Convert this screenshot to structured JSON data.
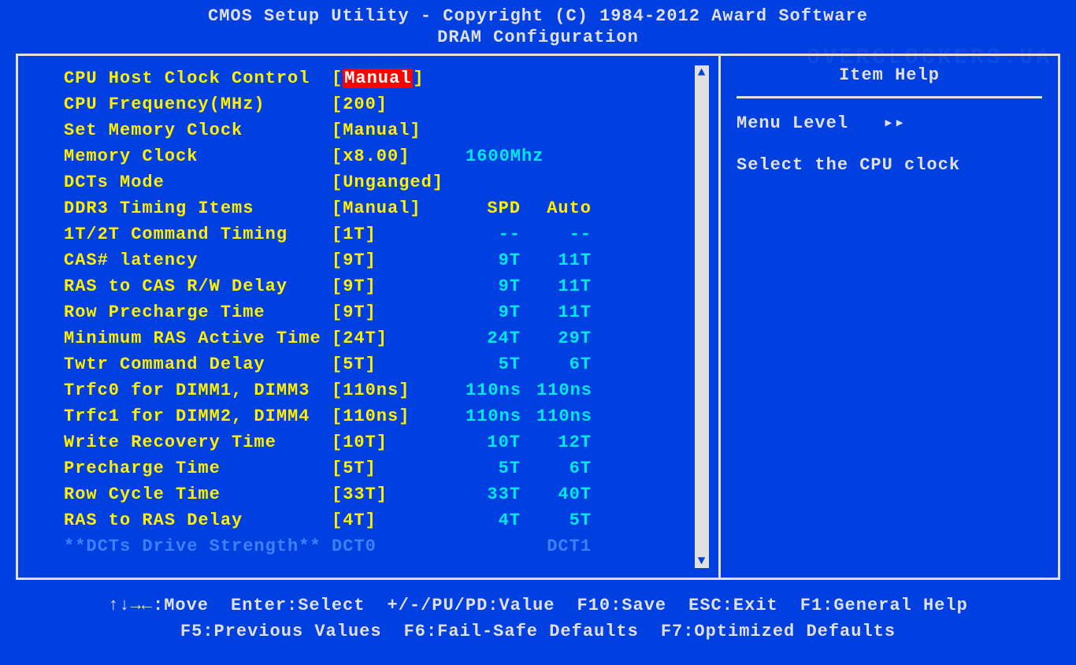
{
  "header": {
    "title": "CMOS Setup Utility - Copyright (C) 1984-2012 Award Software",
    "subtitle": "DRAM Configuration"
  },
  "watermark": "OVERCLOCKERS.UA",
  "settings": [
    {
      "label": "CPU Host Clock Control",
      "value": "Manual",
      "highlighted": true
    },
    {
      "label": "CPU Frequency(MHz)",
      "value": "200"
    },
    {
      "label": "Set Memory Clock",
      "value": "Manual"
    },
    {
      "label": "Memory Clock",
      "value": "x8.00",
      "extra": "1600Mhz"
    },
    {
      "label": "DCTs Mode",
      "value": "Unganged"
    },
    {
      "label": "DDR3 Timing Items",
      "value": "Manual",
      "spd": "SPD",
      "auto": "Auto",
      "header": true
    },
    {
      "label": "1T/2T Command Timing",
      "value": "1T",
      "spd": "--",
      "auto": "--"
    },
    {
      "label": "CAS# latency",
      "value": "9T",
      "spd": "9T",
      "auto": "11T"
    },
    {
      "label": "RAS to CAS R/W Delay",
      "value": "9T",
      "spd": "9T",
      "auto": "11T"
    },
    {
      "label": "Row Precharge Time",
      "value": "9T",
      "spd": "9T",
      "auto": "11T"
    },
    {
      "label": "Minimum RAS Active Time",
      "value": "24T",
      "spd": "24T",
      "auto": "29T"
    },
    {
      "label": "Twtr Command Delay",
      "value": "5T",
      "spd": "5T",
      "auto": "6T"
    },
    {
      "label": "Trfc0 for DIMM1, DIMM3",
      "value": "110ns",
      "spd": "110ns",
      "auto": "110ns"
    },
    {
      "label": "Trfc1 for DIMM2, DIMM4",
      "value": "110ns",
      "spd": "110ns",
      "auto": "110ns"
    },
    {
      "label": "Write Recovery Time",
      "value": "10T",
      "spd": "10T",
      "auto": "12T"
    },
    {
      "label": "Precharge Time",
      "value": "5T",
      "spd": "5T",
      "auto": "6T"
    },
    {
      "label": "Row Cycle Time",
      "value": "33T",
      "spd": "33T",
      "auto": "40T"
    },
    {
      "label": "RAS to RAS Delay",
      "value": "4T",
      "spd": "4T",
      "auto": "5T"
    },
    {
      "label": "**DCTs Drive Strength**",
      "value": "DCT0",
      "spd": "",
      "auto": "DCT1",
      "dim": true,
      "plain": true
    }
  ],
  "help": {
    "title": "Item Help",
    "menu_level": "Menu Level",
    "arrows": "▸▸",
    "description": "Select the CPU clock"
  },
  "footer": {
    "line1": [
      "↑↓→←:Move",
      "Enter:Select",
      "+/-/PU/PD:Value",
      "F10:Save",
      "ESC:Exit",
      "F1:General Help"
    ],
    "line2": [
      "F5:Previous Values",
      "F6:Fail-Safe Defaults",
      "F7:Optimized Defaults"
    ]
  }
}
